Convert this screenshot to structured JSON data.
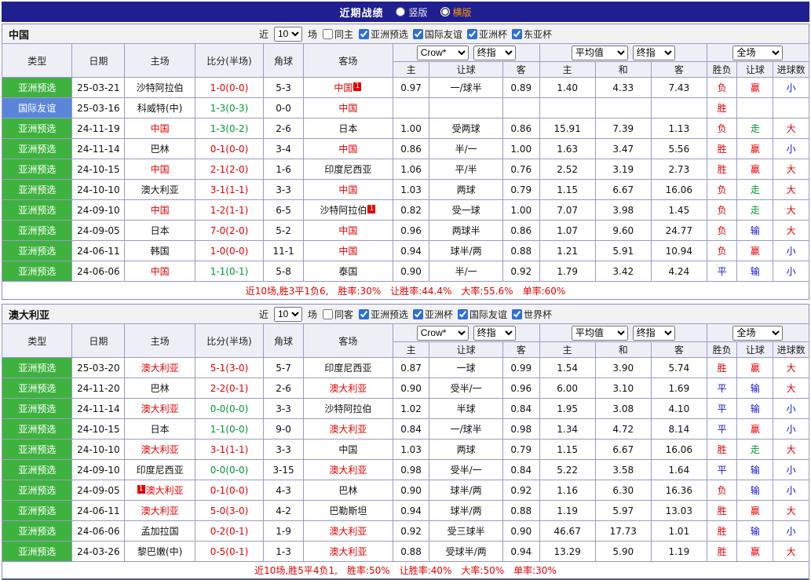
{
  "topbar": {
    "title": "近期战绩",
    "vertical": "竖版",
    "horizontal": "横版"
  },
  "columns": {
    "type": "类型",
    "date": "日期",
    "home": "主场",
    "score": "比分(半场)",
    "corner": "角球",
    "away": "客场",
    "h_home": "主",
    "h_handicap": "让球",
    "h_away": "客",
    "a_home": "主",
    "a_draw": "和",
    "a_away": "客",
    "r_result": "胜负",
    "r_handicap": "让球",
    "r_goals": "进球数"
  },
  "selects": {
    "source": "Crow*",
    "final1": "终指",
    "average": "平均值",
    "final2": "终指",
    "fullmatch": "全场"
  },
  "colors": {
    "accent_navy": "#1f1f90",
    "type_green": "#3eb23e",
    "type_blue": "#5b86d8",
    "win_red": "#e60000",
    "push_green": "#009933",
    "lose_blue": "#1414cc"
  },
  "sections": [
    {
      "team": "中国",
      "filter": {
        "near": "近",
        "count": "10",
        "games": "场",
        "venue": "同主",
        "competitions": [
          "亚洲预选",
          "国际友谊",
          "亚洲杯",
          "东亚杯"
        ]
      },
      "rows": [
        {
          "type": "亚洲预选",
          "tc": "g",
          "date": "25-03-21",
          "home": "沙特阿拉伯",
          "hc": "",
          "hb": "",
          "hbp": "",
          "score": "1-0(0-0)",
          "sc": "red",
          "corner": "5-3",
          "away": "中国",
          "ac": "red",
          "ab": "1",
          "abp": "after",
          "o": [
            "0.97",
            "一/球半",
            "0.89",
            "1.40",
            "4.33",
            "7.43"
          ],
          "r": [
            "负",
            "赢",
            "小"
          ],
          "rc": [
            "red",
            "red",
            "blue"
          ]
        },
        {
          "type": "国际友谊",
          "tc": "b",
          "date": "25-03-16",
          "home": "科威特(中)",
          "hc": "",
          "hb": "",
          "hbp": "",
          "score": "1-3(0-3)",
          "sc": "green",
          "corner": "0-0",
          "away": "中国",
          "ac": "red",
          "ab": "",
          "abp": "",
          "o": [
            "",
            "",
            "",
            "",
            "",
            ""
          ],
          "r": [
            "胜",
            "",
            ""
          ],
          "rc": [
            "red",
            "",
            ""
          ]
        },
        {
          "type": "亚洲预选",
          "tc": "g",
          "date": "24-11-19",
          "home": "中国",
          "hc": "red",
          "hb": "",
          "hbp": "",
          "score": "1-3(0-2)",
          "sc": "green",
          "corner": "2-6",
          "away": "日本",
          "ac": "",
          "ab": "",
          "abp": "",
          "o": [
            "1.00",
            "受两球",
            "0.86",
            "15.91",
            "7.39",
            "1.13"
          ],
          "r": [
            "负",
            "走",
            "大"
          ],
          "rc": [
            "red",
            "green",
            "red"
          ]
        },
        {
          "type": "亚洲预选",
          "tc": "g",
          "date": "24-11-14",
          "home": "巴林",
          "hc": "",
          "hb": "",
          "hbp": "",
          "score": "0-1(0-0)",
          "sc": "red",
          "corner": "3-4",
          "away": "中国",
          "ac": "red",
          "ab": "",
          "abp": "",
          "o": [
            "0.86",
            "半/一",
            "1.00",
            "1.63",
            "3.47",
            "5.56"
          ],
          "r": [
            "胜",
            "赢",
            "小"
          ],
          "rc": [
            "red",
            "red",
            "blue"
          ]
        },
        {
          "type": "亚洲预选",
          "tc": "g",
          "date": "24-10-15",
          "home": "中国",
          "hc": "red",
          "hb": "",
          "hbp": "",
          "score": "2-1(2-0)",
          "sc": "red",
          "corner": "1-6",
          "away": "印度尼西亚",
          "ac": "",
          "ab": "",
          "abp": "",
          "o": [
            "1.06",
            "平/半",
            "0.76",
            "2.52",
            "3.19",
            "2.73"
          ],
          "r": [
            "胜",
            "赢",
            "大"
          ],
          "rc": [
            "red",
            "red",
            "red"
          ]
        },
        {
          "type": "亚洲预选",
          "tc": "g",
          "date": "24-10-10",
          "home": "澳大利亚",
          "hc": "",
          "hb": "",
          "hbp": "",
          "score": "3-1(1-1)",
          "sc": "red",
          "corner": "3-3",
          "away": "中国",
          "ac": "red",
          "ab": "",
          "abp": "",
          "o": [
            "1.03",
            "两球",
            "0.79",
            "1.15",
            "6.67",
            "16.06"
          ],
          "r": [
            "负",
            "走",
            "大"
          ],
          "rc": [
            "red",
            "green",
            "red"
          ]
        },
        {
          "type": "亚洲预选",
          "tc": "g",
          "date": "24-09-10",
          "home": "中国",
          "hc": "red",
          "hb": "",
          "hbp": "",
          "score": "1-2(1-1)",
          "sc": "red",
          "corner": "6-5",
          "away": "沙特阿拉伯",
          "ac": "",
          "ab": "1",
          "abp": "after",
          "o": [
            "0.82",
            "受一球",
            "1.00",
            "7.07",
            "3.98",
            "1.45"
          ],
          "r": [
            "负",
            "走",
            "大"
          ],
          "rc": [
            "red",
            "green",
            "red"
          ]
        },
        {
          "type": "亚洲预选",
          "tc": "g",
          "date": "24-09-05",
          "home": "日本",
          "hc": "",
          "hb": "",
          "hbp": "",
          "score": "7-0(2-0)",
          "sc": "red",
          "corner": "5-2",
          "away": "中国",
          "ac": "red",
          "ab": "",
          "abp": "",
          "o": [
            "0.96",
            "两球半",
            "0.86",
            "1.07",
            "9.60",
            "24.77"
          ],
          "r": [
            "负",
            "输",
            "大"
          ],
          "rc": [
            "red",
            "blue",
            "red"
          ]
        },
        {
          "type": "亚洲预选",
          "tc": "g",
          "date": "24-06-11",
          "home": "韩国",
          "hc": "",
          "hb": "",
          "hbp": "",
          "score": "1-0(0-0)",
          "sc": "red",
          "corner": "11-1",
          "away": "中国",
          "ac": "red",
          "ab": "",
          "abp": "",
          "o": [
            "0.94",
            "球半/两",
            "0.88",
            "1.21",
            "5.91",
            "10.94"
          ],
          "r": [
            "负",
            "赢",
            "小"
          ],
          "rc": [
            "red",
            "red",
            "blue"
          ]
        },
        {
          "type": "亚洲预选",
          "tc": "g",
          "date": "24-06-06",
          "home": "中国",
          "hc": "red",
          "hb": "",
          "hbp": "",
          "score": "1-1(0-1)",
          "sc": "green",
          "corner": "5-8",
          "away": "泰国",
          "ac": "",
          "ab": "",
          "abp": "",
          "o": [
            "0.90",
            "半/一",
            "0.92",
            "1.79",
            "3.42",
            "4.24"
          ],
          "r": [
            "平",
            "输",
            "小"
          ],
          "rc": [
            "blue",
            "blue",
            "blue"
          ]
        }
      ],
      "summary": {
        "prefix": "近10场,胜3平1负6,",
        "win": "胜率:30%",
        "handicap": "让胜率:44.4%",
        "big": "大率:55.6%",
        "single": "单率:60%"
      }
    },
    {
      "team": "澳大利亚",
      "filter": {
        "near": "近",
        "count": "10",
        "games": "场",
        "venue": "同客",
        "competitions": [
          "亚洲预选",
          "亚洲杯",
          "国际友谊",
          "世界杯"
        ]
      },
      "rows": [
        {
          "type": "亚洲预选",
          "tc": "g",
          "date": "25-03-20",
          "home": "澳大利亚",
          "hc": "red",
          "hb": "",
          "hbp": "",
          "score": "5-1(3-0)",
          "sc": "red",
          "corner": "5-7",
          "away": "印度尼西亚",
          "ac": "",
          "ab": "",
          "abp": "",
          "o": [
            "0.87",
            "一球",
            "0.99",
            "1.54",
            "3.90",
            "5.74"
          ],
          "r": [
            "胜",
            "赢",
            "大"
          ],
          "rc": [
            "red",
            "red",
            "red"
          ]
        },
        {
          "type": "亚洲预选",
          "tc": "g",
          "date": "24-11-20",
          "home": "巴林",
          "hc": "",
          "hb": "",
          "hbp": "",
          "score": "2-2(0-1)",
          "sc": "red",
          "corner": "2-6",
          "away": "澳大利亚",
          "ac": "red",
          "ab": "",
          "abp": "",
          "o": [
            "0.90",
            "受半/一",
            "0.96",
            "6.00",
            "3.10",
            "1.69"
          ],
          "r": [
            "平",
            "输",
            "大"
          ],
          "rc": [
            "blue",
            "blue",
            "red"
          ]
        },
        {
          "type": "亚洲预选",
          "tc": "g",
          "date": "24-11-14",
          "home": "澳大利亚",
          "hc": "red",
          "hb": "",
          "hbp": "",
          "score": "0-0(0-0)",
          "sc": "green",
          "corner": "3-3",
          "away": "沙特阿拉伯",
          "ac": "",
          "ab": "",
          "abp": "",
          "o": [
            "1.02",
            "半球",
            "0.84",
            "1.95",
            "3.08",
            "4.10"
          ],
          "r": [
            "平",
            "输",
            "小"
          ],
          "rc": [
            "blue",
            "blue",
            "blue"
          ]
        },
        {
          "type": "亚洲预选",
          "tc": "g",
          "date": "24-10-15",
          "home": "日本",
          "hc": "",
          "hb": "",
          "hbp": "",
          "score": "1-1(0-0)",
          "sc": "green",
          "corner": "9-0",
          "away": "澳大利亚",
          "ac": "red",
          "ab": "",
          "abp": "",
          "o": [
            "0.84",
            "一/球半",
            "0.98",
            "1.34",
            "4.72",
            "8.14"
          ],
          "r": [
            "平",
            "赢",
            "小"
          ],
          "rc": [
            "blue",
            "red",
            "blue"
          ]
        },
        {
          "type": "亚洲预选",
          "tc": "g",
          "date": "24-10-10",
          "home": "澳大利亚",
          "hc": "red",
          "hb": "",
          "hbp": "",
          "score": "3-1(1-1)",
          "sc": "red",
          "corner": "3-3",
          "away": "中国",
          "ac": "",
          "ab": "",
          "abp": "",
          "o": [
            "1.03",
            "两球",
            "0.79",
            "1.15",
            "6.67",
            "16.06"
          ],
          "r": [
            "胜",
            "走",
            "大"
          ],
          "rc": [
            "red",
            "green",
            "red"
          ]
        },
        {
          "type": "亚洲预选",
          "tc": "g",
          "date": "24-09-10",
          "home": "印度尼西亚",
          "hc": "",
          "hb": "",
          "hbp": "",
          "score": "0-0(0-0)",
          "sc": "green",
          "corner": "3-15",
          "away": "澳大利亚",
          "ac": "red",
          "ab": "",
          "abp": "",
          "o": [
            "0.98",
            "受半/一",
            "0.84",
            "5.22",
            "3.58",
            "1.64"
          ],
          "r": [
            "平",
            "输",
            "小"
          ],
          "rc": [
            "blue",
            "blue",
            "blue"
          ]
        },
        {
          "type": "亚洲预选",
          "tc": "g",
          "date": "24-09-05",
          "home": "澳大利亚",
          "hc": "red",
          "hb": "1",
          "hbp": "before",
          "score": "0-1(0-0)",
          "sc": "red",
          "corner": "4-3",
          "away": "巴林",
          "ac": "",
          "ab": "",
          "abp": "",
          "o": [
            "0.90",
            "球半/两",
            "0.92",
            "1.16",
            "6.30",
            "16.36"
          ],
          "r": [
            "负",
            "输",
            "小"
          ],
          "rc": [
            "red",
            "blue",
            "blue"
          ]
        },
        {
          "type": "亚洲预选",
          "tc": "g",
          "date": "24-06-11",
          "home": "澳大利亚",
          "hc": "red",
          "hb": "",
          "hbp": "",
          "score": "5-0(3-0)",
          "sc": "red",
          "corner": "4-2",
          "away": "巴勒斯坦",
          "ac": "",
          "ab": "",
          "abp": "",
          "o": [
            "0.94",
            "球半/两",
            "0.88",
            "1.19",
            "5.97",
            "13.03"
          ],
          "r": [
            "胜",
            "赢",
            "大"
          ],
          "rc": [
            "red",
            "red",
            "red"
          ]
        },
        {
          "type": "亚洲预选",
          "tc": "g",
          "date": "24-06-06",
          "home": "孟加拉国",
          "hc": "",
          "hb": "",
          "hbp": "",
          "score": "0-2(0-1)",
          "sc": "red",
          "corner": "1-9",
          "away": "澳大利亚",
          "ac": "red",
          "ab": "",
          "abp": "",
          "o": [
            "0.92",
            "受三球半",
            "0.90",
            "46.67",
            "17.73",
            "1.01"
          ],
          "r": [
            "胜",
            "输",
            "小"
          ],
          "rc": [
            "red",
            "blue",
            "blue"
          ]
        },
        {
          "type": "亚洲预选",
          "tc": "g",
          "date": "24-03-26",
          "home": "黎巴嫩(中)",
          "hc": "",
          "hb": "",
          "hbp": "",
          "score": "0-5(0-1)",
          "sc": "red",
          "corner": "1-3",
          "away": "澳大利亚",
          "ac": "red",
          "ab": "",
          "abp": "",
          "o": [
            "0.88",
            "受球半/两",
            "0.94",
            "13.29",
            "5.90",
            "1.19"
          ],
          "r": [
            "胜",
            "赢",
            "大"
          ],
          "rc": [
            "red",
            "red",
            "red"
          ]
        }
      ],
      "summary": {
        "prefix": "近10场,胜5平4负1,",
        "win": "胜率:50%",
        "handicap": "让胜率:40%",
        "big": "大率:50%",
        "single": "单率:30%"
      }
    }
  ]
}
